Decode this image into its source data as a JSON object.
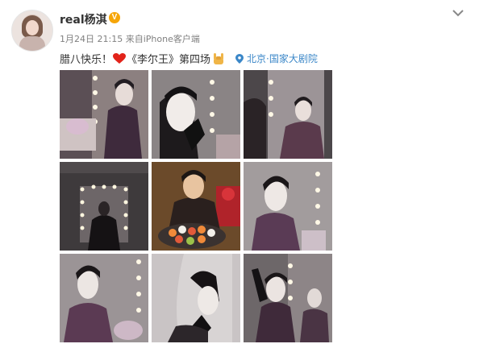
{
  "user": {
    "name": "real杨淇",
    "verified_badge": "V"
  },
  "meta": {
    "date": "1月24日 21:15",
    "source_prefix": "来自",
    "source": "iPhone客户端"
  },
  "post": {
    "text_before": "腊八快乐！",
    "text_after": "《李尔王》第四场",
    "location": "北京·国家大剧院"
  },
  "icons": [
    "avatar",
    "verified-badge-icon",
    "chevron-down-icon",
    "red-heart-icon",
    "rock-hand-icon",
    "location-pin-icon"
  ],
  "colors": {
    "link": "#3b87c8",
    "meta": "#808080",
    "badge": "#f6a609",
    "heart": "#e2231a"
  },
  "photos": [
    {
      "id": 1
    },
    {
      "id": 2
    },
    {
      "id": 3
    },
    {
      "id": 4
    },
    {
      "id": 5
    },
    {
      "id": 6
    },
    {
      "id": 7
    },
    {
      "id": 8
    },
    {
      "id": 9
    }
  ]
}
